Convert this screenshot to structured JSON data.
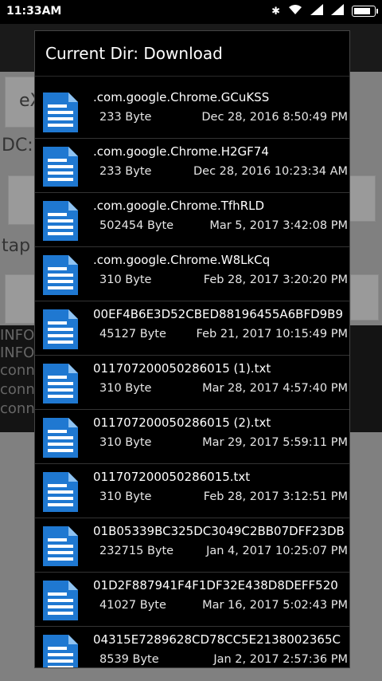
{
  "status_bar": {
    "time": "11:33AM",
    "icons": [
      "bluetooth-icon",
      "wifi-icon",
      "signal-icon",
      "signal-icon",
      "battery-icon"
    ]
  },
  "background": {
    "button_1": "eX",
    "label_dc": "DC:",
    "label_tap": "tap",
    "log_lines": [
      "INFO",
      "INFO",
      "conn",
      "conn",
      "conn"
    ]
  },
  "dialog": {
    "title": "Current Dir: Download",
    "files": [
      {
        "name": ".com.google.Chrome.GCuKSS",
        "size": "233 Byte",
        "date": "Dec 28, 2016 8:50:49 PM"
      },
      {
        "name": ".com.google.Chrome.H2GF74",
        "size": "233 Byte",
        "date": "Dec 28, 2016 10:23:34 AM"
      },
      {
        "name": ".com.google.Chrome.TfhRLD",
        "size": "502454 Byte",
        "date": "Mar 5, 2017 3:42:08 PM"
      },
      {
        "name": ".com.google.Chrome.W8LkCq",
        "size": "310 Byte",
        "date": "Feb 28, 2017 3:20:20 PM"
      },
      {
        "name": "00EF4B6E3D52CBED88196455A6BFD9B9",
        "size": "45127 Byte",
        "date": "Feb 21, 2017 10:15:49 PM"
      },
      {
        "name": "011707200050286015 (1).txt",
        "size": "310 Byte",
        "date": "Mar 28, 2017 4:57:40 PM"
      },
      {
        "name": "011707200050286015 (2).txt",
        "size": "310 Byte",
        "date": "Mar 29, 2017 5:59:11 PM"
      },
      {
        "name": "011707200050286015.txt",
        "size": "310 Byte",
        "date": "Feb 28, 2017 3:12:51 PM"
      },
      {
        "name": "01B05339BC325DC3049C2BB07DFF23DB",
        "size": "232715 Byte",
        "date": "Jan 4, 2017 10:25:07 PM"
      },
      {
        "name": "01D2F887941F4F1DF32E438D8DEFF520",
        "size": "41027 Byte",
        "date": "Mar 16, 2017 5:02:43 PM"
      },
      {
        "name": "04315E7289628CD78CC5E2138002365C",
        "size": "8539 Byte",
        "date": "Jan 2, 2017 2:57:36 PM"
      }
    ]
  },
  "colors": {
    "dialog_bg": "#000000",
    "doc_icon_blue": "#1f78d1"
  }
}
